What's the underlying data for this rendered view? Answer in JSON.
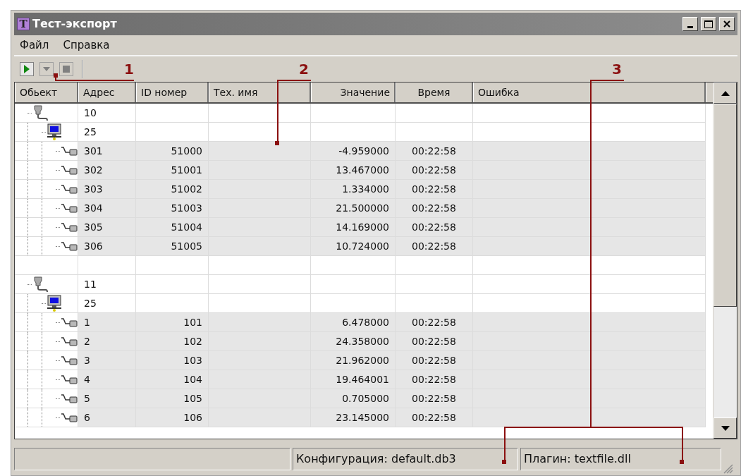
{
  "window": {
    "title": "Тест-экспорт",
    "icon_letter": "T"
  },
  "menu": [
    "Файл",
    "Справка"
  ],
  "toolbar": [
    {
      "kind": "play",
      "disabled": false
    },
    {
      "kind": "dropdown",
      "disabled": true
    },
    {
      "kind": "stop",
      "disabled": true
    }
  ],
  "table": {
    "columns": [
      "Обьект",
      "Адрес",
      "ID номер",
      "Тех. имя",
      "Значение",
      "Время",
      "Ошибка"
    ],
    "groups": [
      {
        "kind": "port",
        "address": "10",
        "children": [
          {
            "kind": "device",
            "address": "25",
            "children": [
              {
                "kind": "tag",
                "address": "301",
                "id": "51000",
                "value": "-4.959000",
                "time": "00:22:58"
              },
              {
                "kind": "tag",
                "address": "302",
                "id": "51001",
                "value": "13.467000",
                "time": "00:22:58"
              },
              {
                "kind": "tag",
                "address": "303",
                "id": "51002",
                "value": "1.334000",
                "time": "00:22:58"
              },
              {
                "kind": "tag",
                "address": "304",
                "id": "51003",
                "value": "21.500000",
                "time": "00:22:58"
              },
              {
                "kind": "tag",
                "address": "305",
                "id": "51004",
                "value": "14.169000",
                "time": "00:22:58"
              },
              {
                "kind": "tag",
                "address": "306",
                "id": "51005",
                "value": "10.724000",
                "time": "00:22:58"
              }
            ]
          }
        ]
      },
      {
        "kind": "port",
        "address": "11",
        "children": [
          {
            "kind": "device",
            "address": "25",
            "children": [
              {
                "kind": "tag",
                "address": "1",
                "id": "101",
                "value": "6.478000",
                "time": "00:22:58"
              },
              {
                "kind": "tag",
                "address": "2",
                "id": "102",
                "value": "24.358000",
                "time": "00:22:58"
              },
              {
                "kind": "tag",
                "address": "3",
                "id": "103",
                "value": "21.962000",
                "time": "00:22:58"
              },
              {
                "kind": "tag",
                "address": "4",
                "id": "104",
                "value": "19.464001",
                "time": "00:22:58"
              },
              {
                "kind": "tag",
                "address": "5",
                "id": "105",
                "value": "0.705000",
                "time": "00:22:58"
              },
              {
                "kind": "tag",
                "address": "6",
                "id": "106",
                "value": "23.145000",
                "time": "00:22:58"
              }
            ]
          }
        ]
      }
    ]
  },
  "status_bar": [
    "Конфигурация: default.db3",
    "Плагин: textfile.dll"
  ],
  "callouts": [
    {
      "label": "1"
    },
    {
      "label": "2"
    },
    {
      "label": "3"
    }
  ]
}
